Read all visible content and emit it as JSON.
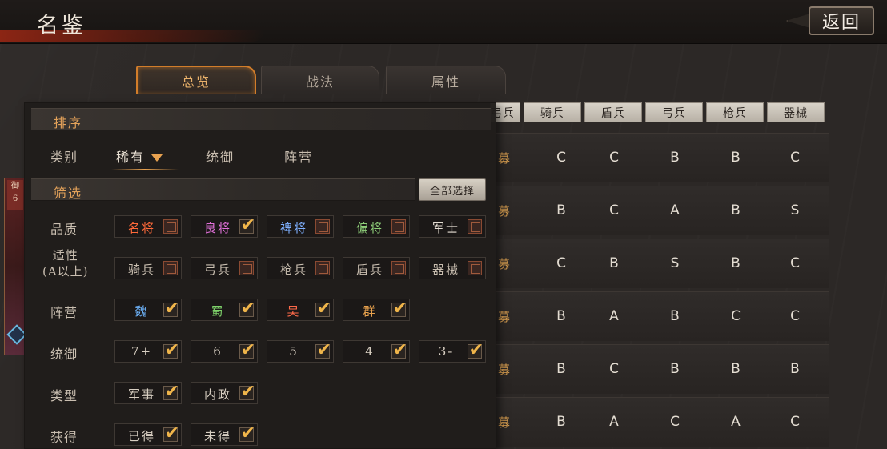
{
  "header": {
    "title": "名鉴",
    "back_label": "返回"
  },
  "tabs": [
    {
      "label": "总览",
      "active": true
    },
    {
      "label": "战法",
      "active": false
    },
    {
      "label": "属性",
      "active": false
    }
  ],
  "table": {
    "columns": [
      "弓兵",
      "骑兵",
      "盾兵",
      "弓兵",
      "枪兵",
      "器械"
    ],
    "row_lead": "募",
    "rows": [
      [
        "C",
        "C",
        "B",
        "B",
        "C"
      ],
      [
        "B",
        "C",
        "A",
        "B",
        "S"
      ],
      [
        "C",
        "B",
        "S",
        "B",
        "C"
      ],
      [
        "B",
        "A",
        "B",
        "C",
        "C"
      ],
      [
        "B",
        "C",
        "B",
        "B",
        "B"
      ],
      [
        "B",
        "A",
        "C",
        "A",
        "C"
      ]
    ]
  },
  "unit_card": {
    "badge_top": "御",
    "badge_num": "6"
  },
  "panel": {
    "sort": {
      "section_label": "排序",
      "row_label": "类别",
      "options": [
        {
          "label": "稀有",
          "active": true
        },
        {
          "label": "统御",
          "active": false
        },
        {
          "label": "阵营",
          "active": false
        }
      ]
    },
    "filter": {
      "section_label": "筛选",
      "select_all_label": "全部选择",
      "rows": [
        {
          "label": "品质",
          "options": [
            {
              "label": "名将",
              "color": "#ff6a3a",
              "checked": false
            },
            {
              "label": "良将",
              "color": "#e070d8",
              "checked": true
            },
            {
              "label": "裨将",
              "color": "#7fb0ff",
              "checked": false
            },
            {
              "label": "偏将",
              "color": "#8fcf7a",
              "checked": false
            },
            {
              "label": "军士",
              "color": "#e4ddd2",
              "checked": false
            }
          ]
        },
        {
          "label_line1": "适性",
          "label_line2": "(A以上)",
          "options": [
            {
              "label": "骑兵",
              "color": "#c9beb0",
              "checked": false
            },
            {
              "label": "弓兵",
              "color": "#c9beb0",
              "checked": false
            },
            {
              "label": "枪兵",
              "color": "#c9beb0",
              "checked": false
            },
            {
              "label": "盾兵",
              "color": "#c9beb0",
              "checked": false
            },
            {
              "label": "器械",
              "color": "#c9beb0",
              "checked": false
            }
          ]
        },
        {
          "label": "阵营",
          "options": [
            {
              "label": "魏",
              "color": "#6fb6ff",
              "checked": true
            },
            {
              "label": "蜀",
              "color": "#7fd36b",
              "checked": true
            },
            {
              "label": "吴",
              "color": "#ff6a4a",
              "checked": true
            },
            {
              "label": "群",
              "color": "#e7a14d",
              "checked": true
            }
          ]
        },
        {
          "label": "统御",
          "options": [
            {
              "label": "7+",
              "color": "#d8cfc2",
              "checked": true
            },
            {
              "label": "6",
              "color": "#d8cfc2",
              "checked": true
            },
            {
              "label": "5",
              "color": "#d8cfc2",
              "checked": true
            },
            {
              "label": "4",
              "color": "#d8cfc2",
              "checked": true
            },
            {
              "label": "3-",
              "color": "#d8cfc2",
              "checked": true
            }
          ]
        },
        {
          "label": "类型",
          "options": [
            {
              "label": "军事",
              "color": "#d8cfc2",
              "checked": true
            },
            {
              "label": "内政",
              "color": "#d8cfc2",
              "checked": true
            }
          ]
        },
        {
          "label": "获得",
          "options": [
            {
              "label": "已得",
              "color": "#d8cfc2",
              "checked": true
            },
            {
              "label": "未得",
              "color": "#d8cfc2",
              "checked": true
            }
          ]
        }
      ]
    }
  }
}
